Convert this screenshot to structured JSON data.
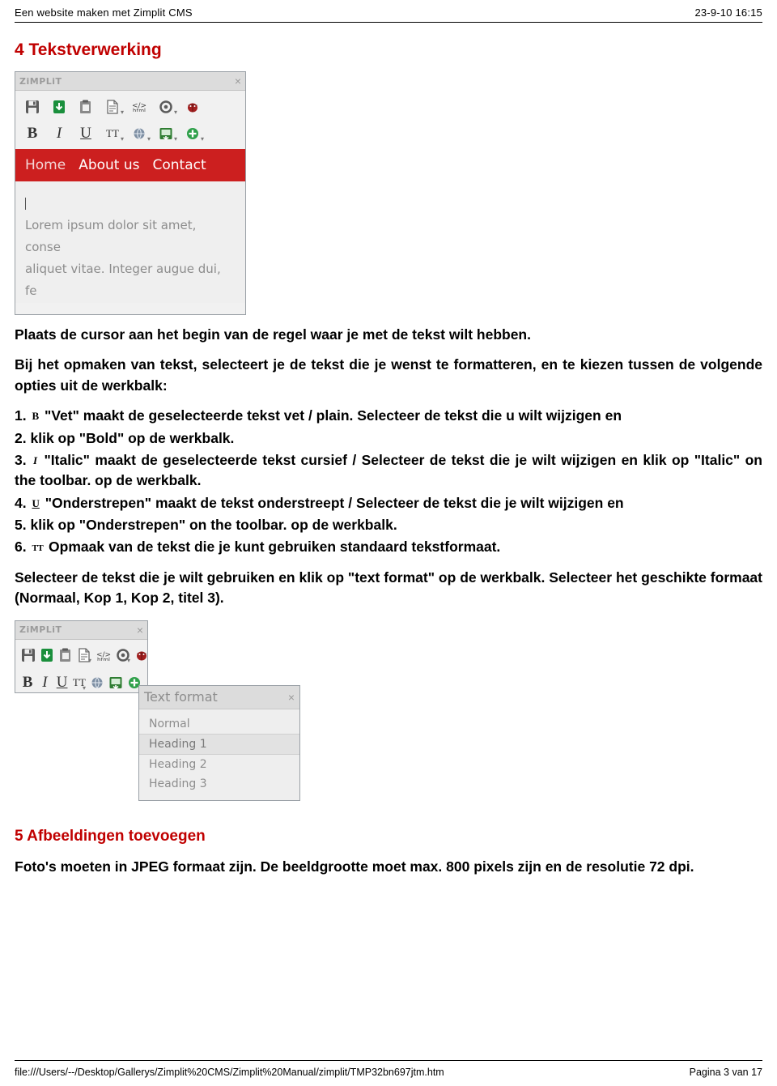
{
  "header": {
    "left": "Een website maken met Zimplit CMS",
    "right": "23-9-10 16:15"
  },
  "sections": {
    "heading4": "4 Tekstverwerking",
    "heading5": "5 Afbeeldingen toevoegen"
  },
  "paragraphs": {
    "p1": "Plaats de cursor aan het begin van de regel waar je met de tekst wilt hebben.",
    "p2": "Bij het opmaken van tekst, selecteert je de tekst die je wenst te formatteren, en te kiezen tussen de volgende opties uit de werkbalk:",
    "p6_tail": "Selecteer de tekst die je wilt gebruiken en klik op \"text format\" op de werkbalk. Selecteer het geschikte formaat (Normaal, Kop 1, Kop 2, titel 3).",
    "p_images": "Foto's moeten in JPEG formaat zijn. De beeldgrootte moet max. 800 pixels zijn en de resolutie 72 dpi."
  },
  "steps": [
    {
      "num": "1.",
      "icon": "bold-icon",
      "icon_glyph": "B",
      "text": "\"Vet\" maakt de geselecteerde tekst vet / plain. Selecteer de tekst die u wilt wijzigen en"
    },
    {
      "num": "2.",
      "icon": "",
      "icon_glyph": "",
      "text": "klik op \"Bold\" op de werkbalk."
    },
    {
      "num": "3.",
      "icon": "italic-icon",
      "icon_glyph": "I",
      "text": "\"Italic\" maakt de geselecteerde tekst cursief / Selecteer de tekst die je wilt wijzigen en klik op \"Italic\" on the toolbar. op de werkbalk."
    },
    {
      "num": "4.",
      "icon": "underline-icon",
      "icon_glyph": "U",
      "text": "\"Onderstrepen\" maakt de tekst onderstreept / Selecteer de tekst die je wilt wijzigen en"
    },
    {
      "num": "5.",
      "icon": "",
      "icon_glyph": "",
      "text": "klik op \"Onderstrepen\" on the toolbar. op de werkbalk."
    },
    {
      "num": "6.",
      "icon": "text-format-icon",
      "icon_glyph": "TT",
      "text": "Opmaak van de tekst die je kunt gebruiken standaard tekstformaat."
    }
  ],
  "editor": {
    "brand": "ZiMPLiT",
    "close": "×",
    "toolbar_row1": [
      {
        "name": "save-icon",
        "label": "save"
      },
      {
        "name": "publish-icon",
        "label": "publish"
      },
      {
        "name": "paste-icon",
        "label": "paste"
      },
      {
        "name": "page-icon",
        "label": "page"
      },
      {
        "name": "html-icon",
        "label": "html"
      },
      {
        "name": "settings-icon",
        "label": "settings"
      },
      {
        "name": "bug-icon",
        "label": "bug"
      }
    ],
    "toolbar_row2": [
      {
        "name": "bold-icon",
        "label": "B"
      },
      {
        "name": "italic-icon",
        "label": "I"
      },
      {
        "name": "underline-icon",
        "label": "U"
      },
      {
        "name": "text-format-icon",
        "label": "TT"
      },
      {
        "name": "link-icon",
        "label": "link"
      },
      {
        "name": "image-icon",
        "label": "image"
      },
      {
        "name": "add-icon",
        "label": "+"
      }
    ],
    "nav": [
      "Home",
      "About us",
      "Contact"
    ],
    "content_line1": "Lorem ipsum dolor sit amet, conse",
    "content_line2": "aliquet vitae. Integer augue dui, fe"
  },
  "popup": {
    "title": "Text format",
    "close": "×",
    "options": [
      "Normal",
      "Heading 1",
      "Heading 2",
      "Heading 3"
    ],
    "selected": "Heading 1"
  },
  "footer": {
    "path": "file:///Users/--/Desktop/Gallerys/Zimplit%20CMS/Zimplit%20Manual/zimplit/TMP32bn697jtm.htm",
    "page": "Pagina 3 van 17"
  },
  "colors": {
    "heading": "#c00000",
    "nav": "#cc1f1f",
    "text": "#000000"
  }
}
